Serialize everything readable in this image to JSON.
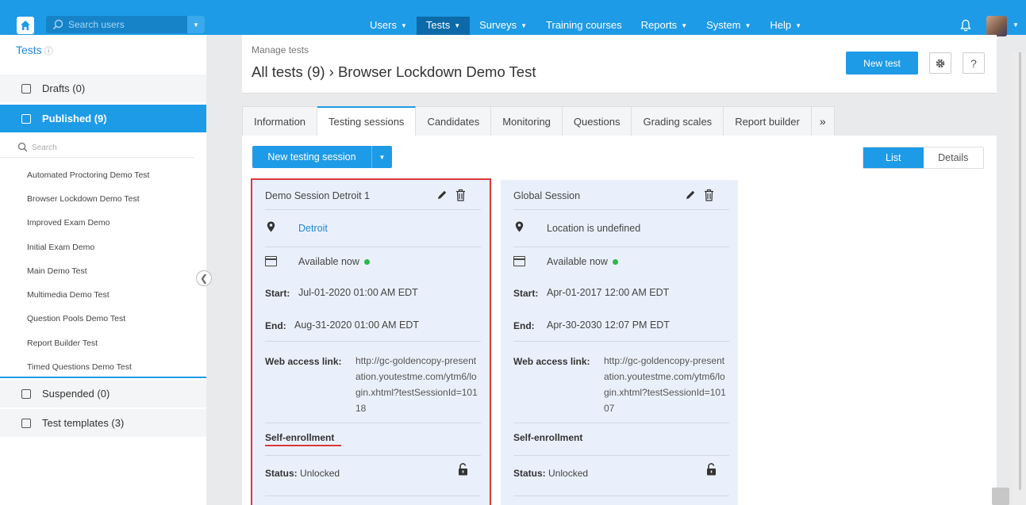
{
  "topbar": {
    "search_placeholder": "Search users",
    "nav": [
      {
        "label": "Users",
        "caret": true,
        "active": false
      },
      {
        "label": "Tests",
        "caret": true,
        "active": true
      },
      {
        "label": "Surveys",
        "caret": true,
        "active": false
      },
      {
        "label": "Training courses",
        "caret": false,
        "active": false
      },
      {
        "label": "Reports",
        "caret": true,
        "active": false
      },
      {
        "label": "System",
        "caret": true,
        "active": false
      },
      {
        "label": "Help",
        "caret": true,
        "active": false
      }
    ]
  },
  "sidebar": {
    "title": "Tests",
    "drafts": "Drafts (0)",
    "published": "Published (9)",
    "search_placeholder": "Search",
    "tests": [
      "Automated Proctoring Demo Test",
      "Browser Lockdown Demo Test",
      "Improved Exam Demo",
      "Initial Exam Demo",
      "Main Demo Test",
      "Multimedia Demo Test",
      "Question Pools Demo Test",
      "Report Builder Test",
      "Timed Questions Demo Test"
    ],
    "suspended": "Suspended (0)",
    "templates": "Test templates (3)"
  },
  "header": {
    "breadcrumb": "Manage tests",
    "title": "All tests (9) › Browser Lockdown Demo Test",
    "new_test": "New test",
    "help": "?"
  },
  "tabs": [
    "Information",
    "Testing sessions",
    "Candidates",
    "Monitoring",
    "Questions",
    "Grading scales",
    "Report builder",
    "»"
  ],
  "toolbar": {
    "new_session": "New testing session",
    "view_list": "List",
    "view_details": "Details"
  },
  "labels": {
    "available": "Available now",
    "start": "Start:",
    "end": "End:",
    "web_access": "Web access link:",
    "self_enrollment": "Self-enrollment",
    "status": "Status:"
  },
  "sessions": [
    {
      "name": "Demo Session Detroit 1",
      "location": "Detroit",
      "location_color": "#1e88d6",
      "start": "Jul-01-2020 01:00 AM EDT",
      "end": "Aug-31-2020 01:00 AM EDT",
      "link": "http://gc-goldencopy-presentation.youtestme.com/ytm6/login.xhtml?testSessionId=10118",
      "status": "Unlocked"
    },
    {
      "name": "Global Session",
      "location": "Location is undefined",
      "location_color": "#444444",
      "start": "Apr-01-2017 12:00 AM EDT",
      "end": "Apr-30-2030 12:07 PM EDT",
      "link": "http://gc-goldencopy-presentation.youtestme.com/ytm6/login.xhtml?testSessionId=10107",
      "status": "Unlocked"
    }
  ],
  "colors": {
    "accent": "#1e9be6",
    "highlight": "#d93a3a",
    "available": "#2bb84a"
  }
}
